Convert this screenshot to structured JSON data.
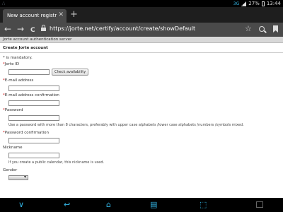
{
  "status_bar": {
    "left_text": "∴",
    "network": "3G",
    "battery": "27%",
    "time": "13:44"
  },
  "tabs": [
    {
      "label": "New account registrati...",
      "close": "✕"
    }
  ],
  "new_tab": "+",
  "address_bar": {
    "back": "←",
    "forward": "→",
    "reload": "C",
    "url": "https://jorte.net/certify/account/create/showDefault",
    "star": "☆"
  },
  "page": {
    "header": "Jorte account authentication server",
    "form_title": "Create Jorte account",
    "mandatory_note": "* is mandatory.",
    "fields": {
      "jorte_id_label": "Jorte ID",
      "check_button": "Check availability",
      "email_label": "E-mail address",
      "email_confirm_label": "E-mail address confirmation",
      "password_label": "Password",
      "password_hint": "Use a password with more than 8 characters, preferably with upper case alphabets /lower case alphabets /numbers /symbols mixed.",
      "password_confirm_label": "Password confirmation",
      "nickname_label": "Nickname",
      "nickname_hint": "If you create a public calendar, this nickname is used.",
      "gender_label": "Gender"
    },
    "asterisk": "*"
  },
  "nav_bar": {
    "down": "∨",
    "back": "↩",
    "home": "⌂",
    "recent": "▤",
    "screenshot": "⬚"
  }
}
